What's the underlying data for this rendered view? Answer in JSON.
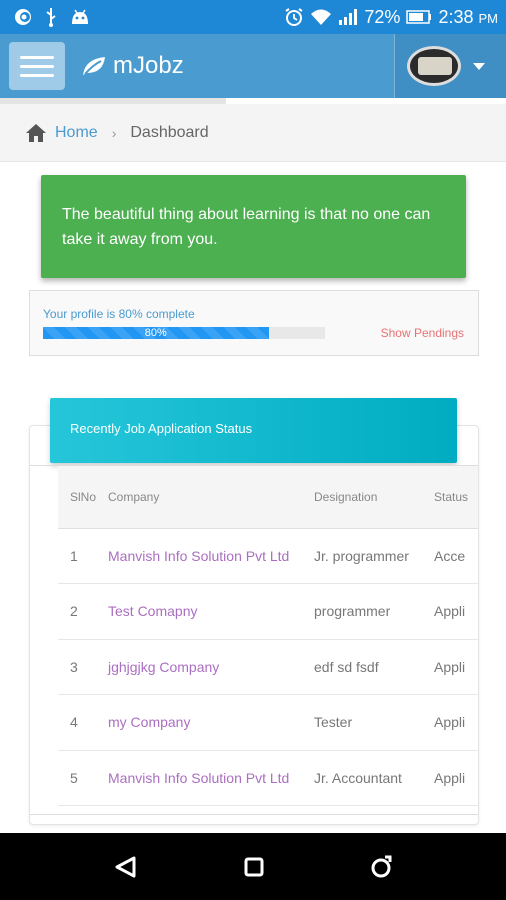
{
  "status_bar": {
    "battery": "72%",
    "time": "2:38",
    "ampm": "PM"
  },
  "app": {
    "brand": "mJobz"
  },
  "breadcrumb": {
    "home": "Home",
    "separator": "›",
    "current": "Dashboard"
  },
  "quote": {
    "text": "The beautiful thing about learning is that no one can take it away from you."
  },
  "profile": {
    "label": "Your profile is 80% complete",
    "progress_value": 80,
    "progress_label": "80%",
    "show_pendings": "Show Pendings"
  },
  "job_status": {
    "title": "Recently Job Application Status",
    "columns": [
      "SlNo",
      "Company",
      "Designation",
      "Status"
    ],
    "rows": [
      {
        "sl": "1",
        "company": "Manvish Info Solution Pvt Ltd",
        "designation": "Jr. programmer",
        "status": "Acce"
      },
      {
        "sl": "2",
        "company": "Test Comapny",
        "designation": "programmer",
        "status": "Appli"
      },
      {
        "sl": "3",
        "company": "jghjgjkg Company",
        "designation": "edf sd fsdf",
        "status": "Appli"
      },
      {
        "sl": "4",
        "company": "my Company",
        "designation": "Tester",
        "status": "Appli"
      },
      {
        "sl": "5",
        "company": "Manvish Info Solution Pvt Ltd",
        "designation": "Jr. Accountant",
        "status": "Appli"
      }
    ]
  },
  "colors": {
    "status_bar": "#1e88d6",
    "app_bar": "#4a9bcf",
    "quote_bg": "#4caf50",
    "card_header": "#00bcd4",
    "company_link": "#ab6fc1",
    "pending": "#e57373"
  },
  "icons": {
    "status_left": [
      "app-c-icon",
      "usb-icon",
      "android-icon"
    ],
    "status_right": [
      "alarm-icon",
      "wifi-icon",
      "signal-icon",
      "battery-icon"
    ],
    "nav": [
      "back-icon",
      "home-square-icon",
      "recents-icon"
    ]
  }
}
